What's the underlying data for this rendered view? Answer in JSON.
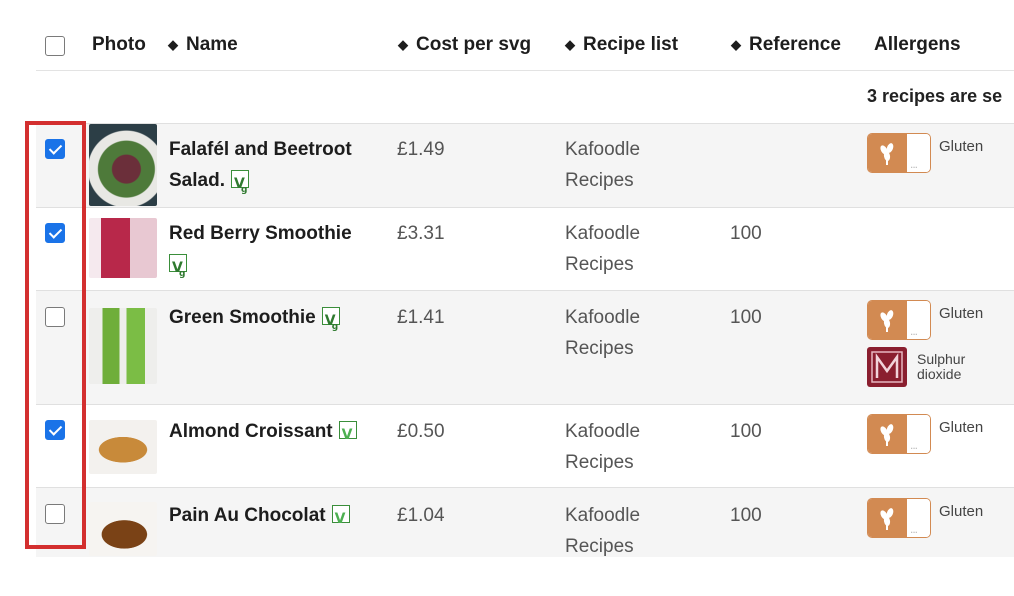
{
  "header": {
    "photo": "Photo",
    "name": "Name",
    "cost": "Cost per svg",
    "recipe_list": "Recipe list",
    "reference": "Reference",
    "allergens": "Allergens",
    "sort_glyph": "▲▼"
  },
  "selection_info": "3 recipes are se",
  "rows": [
    {
      "name_line1": "Falafél and Beetroot",
      "name_line2": "Salad.",
      "badge": "vegan",
      "cost": "£1.49",
      "recipe_list_1": "Kafoodle",
      "recipe_list_2": "Recipes",
      "reference": "",
      "checked": true,
      "allergens": [
        "Gluten"
      ]
    },
    {
      "name_line1": "Red Berry Smoothie",
      "name_line2": "",
      "badge": "vegan",
      "cost": "£3.31",
      "recipe_list_1": "Kafoodle",
      "recipe_list_2": "Recipes",
      "reference": "100",
      "checked": true,
      "allergens": []
    },
    {
      "name_line1": "Green Smoothie",
      "name_line2": "",
      "badge": "vegan",
      "cost": "£1.41",
      "recipe_list_1": "Kafoodle",
      "recipe_list_2": "Recipes",
      "reference": "100",
      "checked": false,
      "allergens": [
        "Gluten",
        "Sulphur",
        "dioxide"
      ]
    },
    {
      "name_line1": "Almond Croissant",
      "name_line2": "",
      "badge": "vegetarian",
      "cost": "£0.50",
      "recipe_list_1": "Kafoodle",
      "recipe_list_2": "Recipes",
      "reference": "100",
      "checked": true,
      "allergens": [
        "Gluten"
      ]
    },
    {
      "name_line1": "Pain Au Chocolat",
      "name_line2": "",
      "badge": "vegetarian",
      "cost": "£1.04",
      "recipe_list_1": "Kafoodle",
      "recipe_list_2": "Recipes",
      "reference": "100",
      "checked": false,
      "allergens": [
        "Gluten"
      ]
    }
  ],
  "colors": {
    "checkbox_checked": "#1a73e8",
    "highlight": "#d32f2f",
    "gluten": "#d28a52",
    "sulphur": "#8a1f2f",
    "badge": "#3a8e3a"
  }
}
